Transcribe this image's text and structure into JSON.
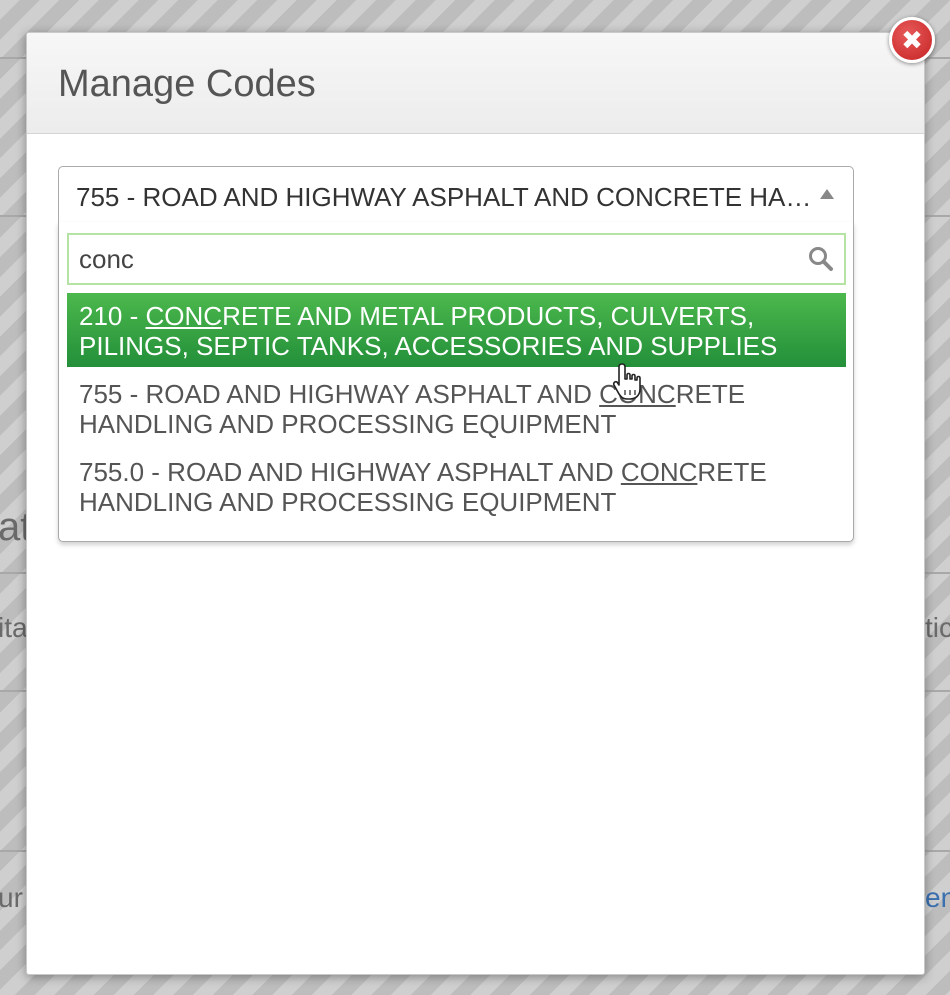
{
  "background": {
    "fragment_left_1": "at",
    "fragment_left_2": "ita",
    "fragment_left_3": "ur",
    "fragment_right_1": "tic",
    "fragment_right_2": "en"
  },
  "modal": {
    "title": "Manage Codes",
    "close_icon": "close-icon"
  },
  "select": {
    "selected_value": "755 - ROAD AND HIGHWAY ASPHALT AND CONCRETE HANDLING AND PROCESSING EQUIPMENT"
  },
  "search": {
    "value": "conc",
    "icon": "search-icon"
  },
  "results": [
    {
      "before": "210 - ",
      "match": "CONC",
      "after": "RETE AND METAL PRODUCTS, CULVERTS, PILINGS, SEPTIC TANKS, ACCESSORIES AND SUPPLIES",
      "highlighted": true
    },
    {
      "before": "755 - ROAD AND HIGHWAY ASPHALT AND ",
      "match": "CONC",
      "after": "RETE HANDLING AND PROCESSING EQUIPMENT",
      "highlighted": false
    },
    {
      "before": "755.0 - ROAD AND HIGHWAY ASPHALT AND ",
      "match": "CONC",
      "after": "RETE HANDLING AND PROCESSING EQUIPMENT",
      "highlighted": false
    }
  ],
  "colors": {
    "highlight_top": "#4cb84c",
    "highlight_bottom": "#238f3a",
    "close_red": "#c52323",
    "search_border": "#b6e3a4"
  }
}
